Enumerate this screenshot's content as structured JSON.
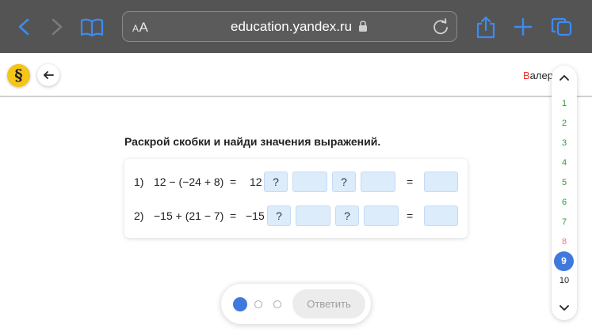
{
  "browser": {
    "url": "education.yandex.ru",
    "text_size": "AA"
  },
  "header": {
    "logo_symbol": "§",
    "user_name_first": "В",
    "user_name_rest": "алер"
  },
  "task": {
    "title": "Раскрой скобки и найди значения выражений.",
    "rows": [
      {
        "num": "1)",
        "expr": "12 − (−24 + 8)",
        "eq": "=",
        "lead": "12",
        "q1": "?",
        "q2": "?",
        "eq2": "="
      },
      {
        "num": "2)",
        "expr": "−15 + (21 − 7)",
        "eq": "=",
        "lead": "−15",
        "q1": "?",
        "q2": "?",
        "eq2": "="
      }
    ]
  },
  "bottom": {
    "answer_label": "Ответить",
    "steps_total": 3,
    "step_active": 1
  },
  "question_nav": {
    "items": [
      {
        "label": "1",
        "state": "done"
      },
      {
        "label": "2",
        "state": "done"
      },
      {
        "label": "3",
        "state": "done"
      },
      {
        "label": "4",
        "state": "done"
      },
      {
        "label": "5",
        "state": "done"
      },
      {
        "label": "6",
        "state": "done"
      },
      {
        "label": "7",
        "state": "done"
      },
      {
        "label": "8",
        "state": "wrong"
      },
      {
        "label": "9",
        "state": "active"
      },
      {
        "label": "10",
        "state": "pending"
      }
    ]
  },
  "colors": {
    "browser_bar": "#545454",
    "accent_blue": "#3a8cf5",
    "active_blue": "#3f79dd",
    "logo_yellow": "#f5c518",
    "done_green": "#2e9b3c",
    "wrong_pink": "#e8778a",
    "input_cell": "#dcecfb"
  }
}
